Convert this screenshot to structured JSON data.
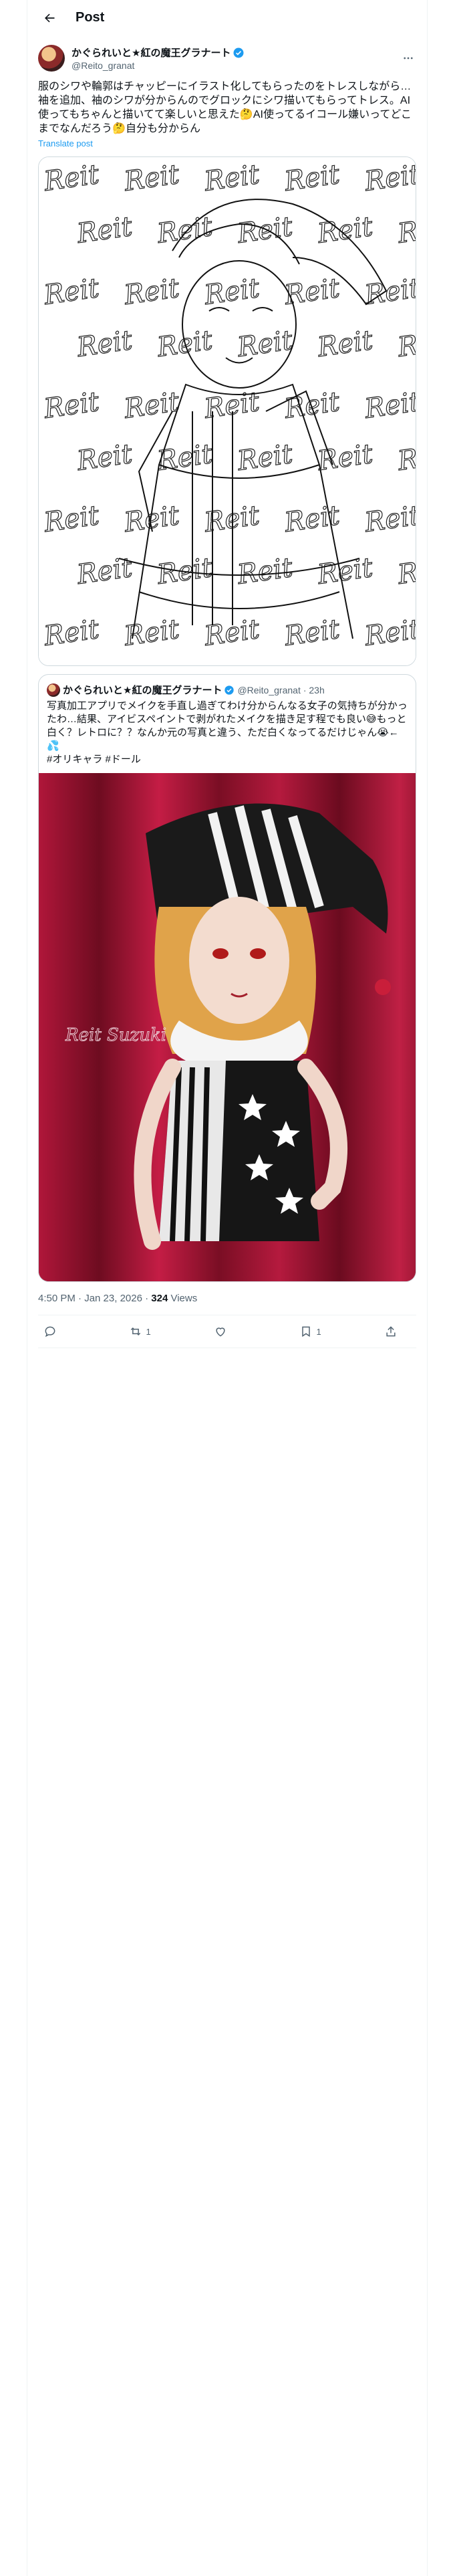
{
  "header": {
    "title": "Post"
  },
  "post": {
    "display_name": "かぐられいと★紅の魔王グラナート",
    "handle": "@Reito_granat",
    "text": "服のシワや輪郭はチャッピーにイラスト化してもらったのをトレスしながら…袖を追加、袖のシワが分からんのでグロックにシワ描いてもらってトレス。AI使ってもちゃんと描いてて楽しいと思えた🤔AI使ってるイコール嫌いってどこまでなんだろう🤔自分も分からん",
    "translate": "Translate post",
    "image_alt": "Line drawing sketch overlaid with repeated Reit signatures",
    "sketch_watermark": "Reit"
  },
  "quote": {
    "display_name": "かぐられいと★紅の魔王グラナート",
    "handle": "@Reito_granat",
    "time": "· 23h",
    "text": "写真加工アプリでメイクを手直し過ぎてわけ分からんなる女子の気持ちが分かったわ…結果、アイビスペイントで剥がれたメイクを描き足す程でも良い😅もっと白く？レトロに？？なんか元の写真と違う、ただ白くなってるだけじゃん😭←💦\n#オリキャラ #ドール",
    "image_alt": "Photo of a jester doll with blonde hair in striped black and white outfit",
    "photo_signature": "Reit Suzuki"
  },
  "meta": {
    "time": "4:50 PM · Jan 23, 2026",
    "separator": "·",
    "views_count": "324",
    "views_label": "Views"
  },
  "actions": {
    "reply_count": "",
    "repost_count": "1",
    "like_count": "",
    "bookmark_count": "1"
  },
  "colors": {
    "accent": "#1d9bf0",
    "text": "#0f1419",
    "muted": "#536471",
    "border": "#cfd9de"
  }
}
